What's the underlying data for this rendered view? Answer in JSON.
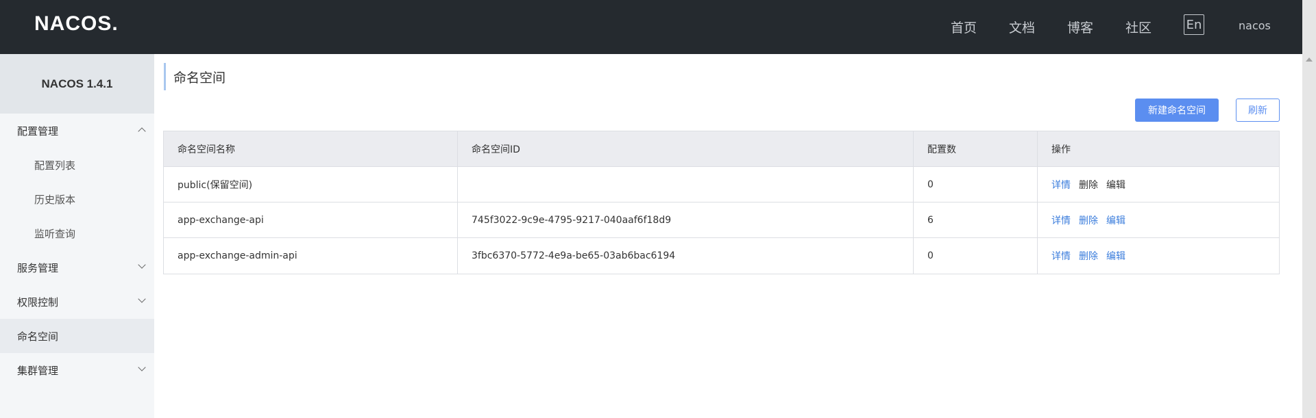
{
  "header": {
    "logo": "NACOS.",
    "nav": [
      {
        "label": "首页"
      },
      {
        "label": "文档"
      },
      {
        "label": "博客"
      },
      {
        "label": "社区"
      }
    ],
    "lang": "En",
    "user": "nacos"
  },
  "sidebar": {
    "version": "NACOS 1.4.1",
    "items": [
      {
        "label": "配置管理"
      },
      {
        "label": "配置列表"
      },
      {
        "label": "历史版本"
      },
      {
        "label": "监听查询"
      },
      {
        "label": "服务管理"
      },
      {
        "label": "权限控制"
      },
      {
        "label": "命名空间"
      },
      {
        "label": "集群管理"
      }
    ]
  },
  "main": {
    "title": "命名空间",
    "new_button": "新建命名空间",
    "refresh_button": "刷新",
    "table": {
      "headers": [
        "命名空间名称",
        "命名空间ID",
        "配置数",
        "操作"
      ],
      "rows": [
        {
          "name": "public(保留空间)",
          "id": "",
          "count": "0",
          "ops": [
            "详情",
            "删除",
            "编辑"
          ]
        },
        {
          "name": "app-exchange-api",
          "id": "745f3022-9c9e-4795-9217-040aaf6f18d9",
          "count": "6",
          "ops": [
            "详情",
            "删除",
            "编辑"
          ]
        },
        {
          "name": "app-exchange-admin-api",
          "id": "3fbc6370-5772-4e9a-be65-03ab6bac6194",
          "count": "0",
          "ops": [
            "详情",
            "删除",
            "编辑"
          ]
        }
      ]
    }
  },
  "colors": {
    "header_bg": "#252a2f",
    "accent": "#5b8ef0",
    "link": "#3b7ddc"
  }
}
